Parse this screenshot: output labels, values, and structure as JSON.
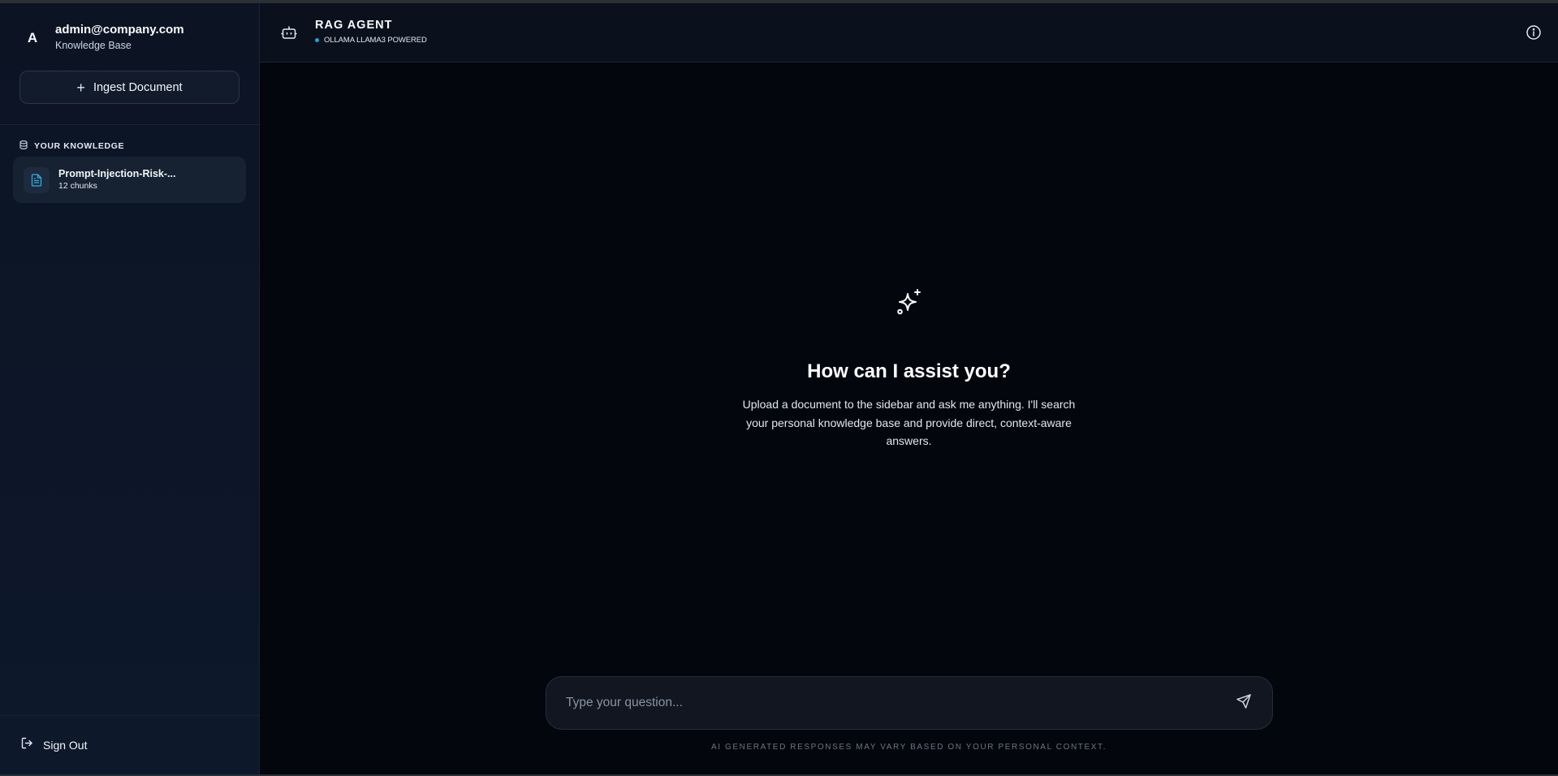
{
  "sidebar": {
    "user": {
      "initial": "A",
      "email": "admin@company.com",
      "subtitle": "Knowledge Base"
    },
    "ingest_label": "Ingest Document",
    "section_title": "YOUR KNOWLEDGE",
    "documents": [
      {
        "name": "Prompt-Injection-Risk-...",
        "meta": "12 chunks"
      }
    ],
    "sign_out_label": "Sign Out"
  },
  "header": {
    "title": "RAG AGENT",
    "status": "OLLAMA LLAMA3 POWERED"
  },
  "welcome": {
    "heading": "How can I assist you?",
    "body": "Upload a document to the sidebar and ask me anything. I'll search your personal knowledge base and provide direct, context-aware answers."
  },
  "composer": {
    "placeholder": "Type your question...",
    "value": ""
  },
  "disclaimer": "AI GENERATED RESPONSES MAY VARY BASED ON YOUR PERSONAL CONTEXT.",
  "colors": {
    "accent": "#22a3d8",
    "background": "#03060d",
    "sidebar": "#0c1424"
  }
}
